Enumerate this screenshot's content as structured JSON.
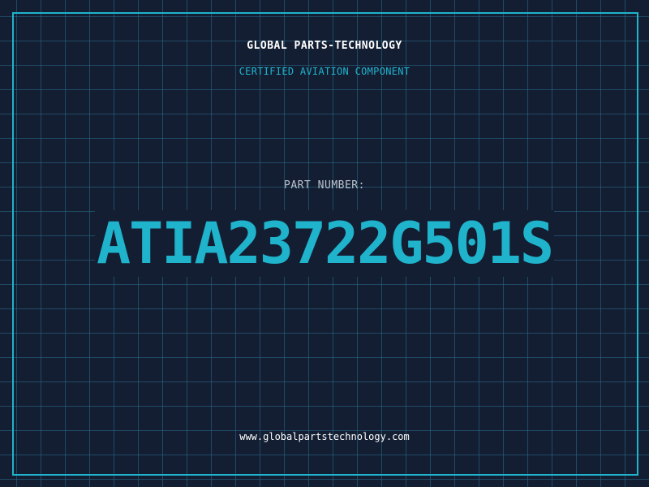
{
  "header": {
    "company_name": "GLOBAL PARTS-TECHNOLOGY",
    "subtitle": "CERTIFIED AVIATION COMPONENT"
  },
  "part": {
    "label": "PART NUMBER:",
    "number": "ATIA23722G501S"
  },
  "footer": {
    "website": "www.globalpartstechnology.com"
  },
  "colors": {
    "background": "#141e33",
    "grid": "#286e8c",
    "accent": "#1fb3cc",
    "text_primary": "#ffffff",
    "text_secondary": "#b8c2cc"
  }
}
